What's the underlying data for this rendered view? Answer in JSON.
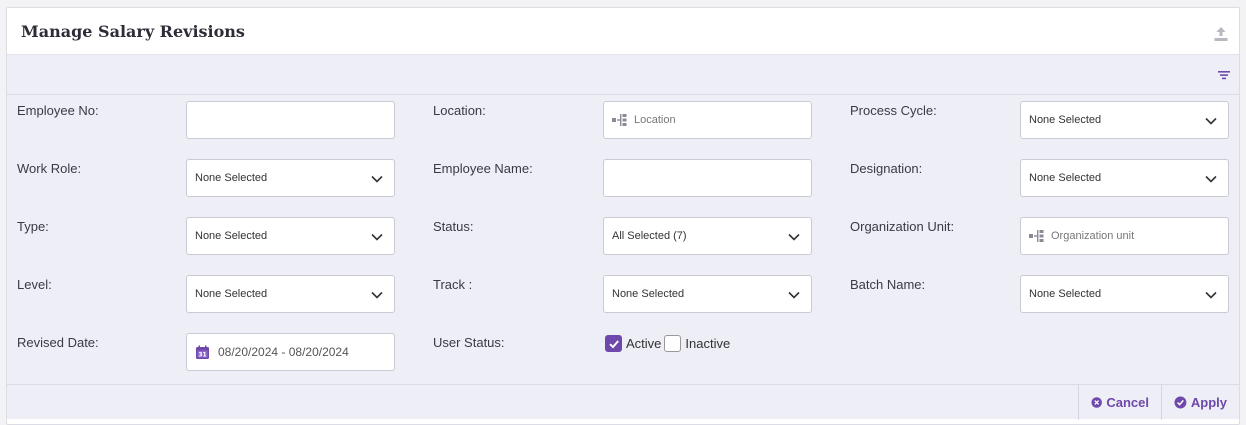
{
  "header": {
    "title": "Manage Salary Revisions"
  },
  "filters": {
    "employee_no": {
      "label": "Employee No:",
      "value": ""
    },
    "location": {
      "label": "Location:",
      "placeholder": "Location"
    },
    "process_cycle": {
      "label": "Process Cycle:",
      "value": "None Selected"
    },
    "work_role": {
      "label": "Work Role:",
      "value": "None Selected"
    },
    "employee_name": {
      "label": "Employee Name:",
      "value": ""
    },
    "designation": {
      "label": "Designation:",
      "value": "None Selected"
    },
    "type": {
      "label": "Type:",
      "value": "None Selected"
    },
    "status": {
      "label": "Status:",
      "value": "All Selected (7)"
    },
    "organization_unit": {
      "label": "Organization Unit:",
      "placeholder": "Organization unit"
    },
    "level": {
      "label": "Level:",
      "value": "None Selected"
    },
    "track": {
      "label": "Track :",
      "value": "None Selected"
    },
    "batch_name": {
      "label": "Batch Name:",
      "value": "None Selected"
    },
    "revised_date": {
      "label": "Revised Date:",
      "value": "08/20/2024 - 08/20/2024"
    },
    "user_status": {
      "label": "User Status:",
      "options": [
        {
          "label": "Active",
          "checked": true
        },
        {
          "label": "Inactive",
          "checked": false
        }
      ]
    }
  },
  "actions": {
    "cancel_label": "Cancel",
    "apply_label": "Apply"
  },
  "colors": {
    "accent": "#6e48aa",
    "panel_bg": "#edeef6"
  }
}
